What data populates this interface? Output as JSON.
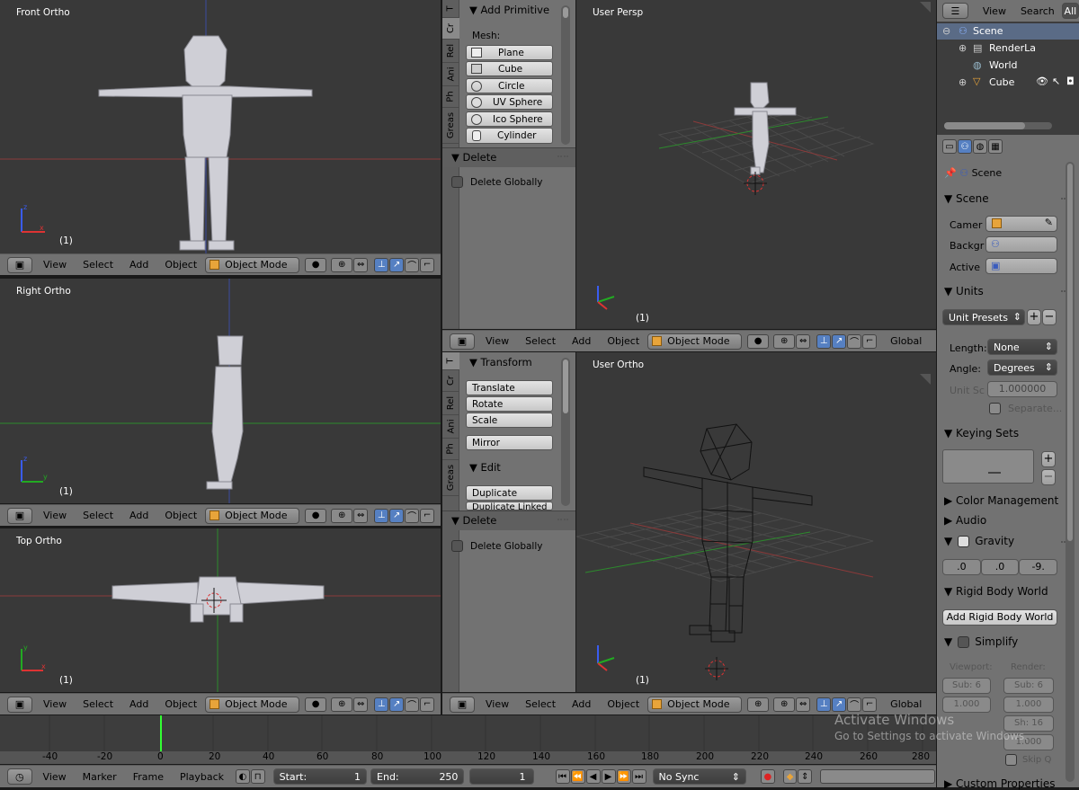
{
  "viewports": {
    "front": {
      "title": "Front Ortho",
      "frame": "(1)"
    },
    "right": {
      "title": "Right Ortho",
      "frame": "(1)"
    },
    "top": {
      "title": "Top Ortho",
      "frame": "(1)"
    },
    "persp": {
      "title": "User Persp",
      "frame": "(1)"
    },
    "userortho": {
      "title": "User Ortho",
      "frame": "(1)"
    }
  },
  "header": {
    "view": "View",
    "select": "Select",
    "add": "Add",
    "object": "Object",
    "mode": "Object Mode",
    "orientation": "Global"
  },
  "tool_top": {
    "tabs": [
      "T",
      "Cr",
      "Rel",
      "Ani",
      "Ph",
      "Greas"
    ],
    "panel_title": "Add Primitive",
    "mesh_label": "Mesh:",
    "primitives": [
      "Plane",
      "Cube",
      "Circle",
      "UV Sphere",
      "Ico Sphere",
      "Cylinder"
    ],
    "delete_title": "Delete",
    "delete_globally": "Delete Globally"
  },
  "tool_bottom": {
    "tabs": [
      "T",
      "Cr",
      "Rel",
      "Ani",
      "Ph",
      "Greas"
    ],
    "transform_title": "Transform",
    "transform_buttons": [
      "Translate",
      "Rotate",
      "Scale"
    ],
    "mirror": "Mirror",
    "edit_title": "Edit",
    "edit_buttons": [
      "Duplicate",
      "Duplicate Linked"
    ],
    "delete_title": "Delete",
    "delete_globally": "Delete Globally"
  },
  "outliner": {
    "view": "View",
    "search": "Search",
    "all": "All",
    "items": [
      "Scene",
      "RenderLa",
      "World",
      "Cube"
    ]
  },
  "properties": {
    "breadcrumb": "Scene",
    "scene_panel": "Scene",
    "camera_label": "Camer",
    "background_label": "Backgr",
    "active_label": "Active",
    "units_panel": "Units",
    "unit_presets": "Unit Presets",
    "length_label": "Length:",
    "length_value": "None",
    "angle_label": "Angle:",
    "angle_value": "Degrees",
    "unit_scale_label": "Unit Sc",
    "unit_scale_value": "1.000000",
    "separate": "Separate...",
    "keying_sets": "Keying Sets",
    "color_management": "Color Management",
    "audio": "Audio",
    "gravity": "Gravity",
    "gravity_values": [
      ".0",
      ".0",
      "-9."
    ],
    "rigid_body_world": "Rigid Body World",
    "add_rigid_body_world": "Add Rigid Body World",
    "simplify": "Simplify",
    "viewport_label": "Viewport:",
    "render_label": "Render:",
    "sub_viewport": "Sub: 6",
    "sub_render": "Sub: 6",
    "v_val": "1.000",
    "r_val": "1.000",
    "sh": "Sh: 16",
    "r_val2": "1.000",
    "skip_q": "Skip Q",
    "custom_properties": "Custom Properties"
  },
  "timeline": {
    "ticks": [
      "-40",
      "-20",
      "0",
      "20",
      "40",
      "60",
      "80",
      "100",
      "120",
      "140",
      "160",
      "180",
      "200",
      "220",
      "240",
      "260",
      "280"
    ],
    "view": "View",
    "marker": "Marker",
    "frame": "Frame",
    "playback": "Playback",
    "start_label": "Start:",
    "start_value": "1",
    "end_label": "End:",
    "end_value": "250",
    "current_frame": "1",
    "sync": "No Sync"
  },
  "watermark": {
    "line1": "Activate Windows",
    "line2": "Go to Settings to activate Windows."
  }
}
